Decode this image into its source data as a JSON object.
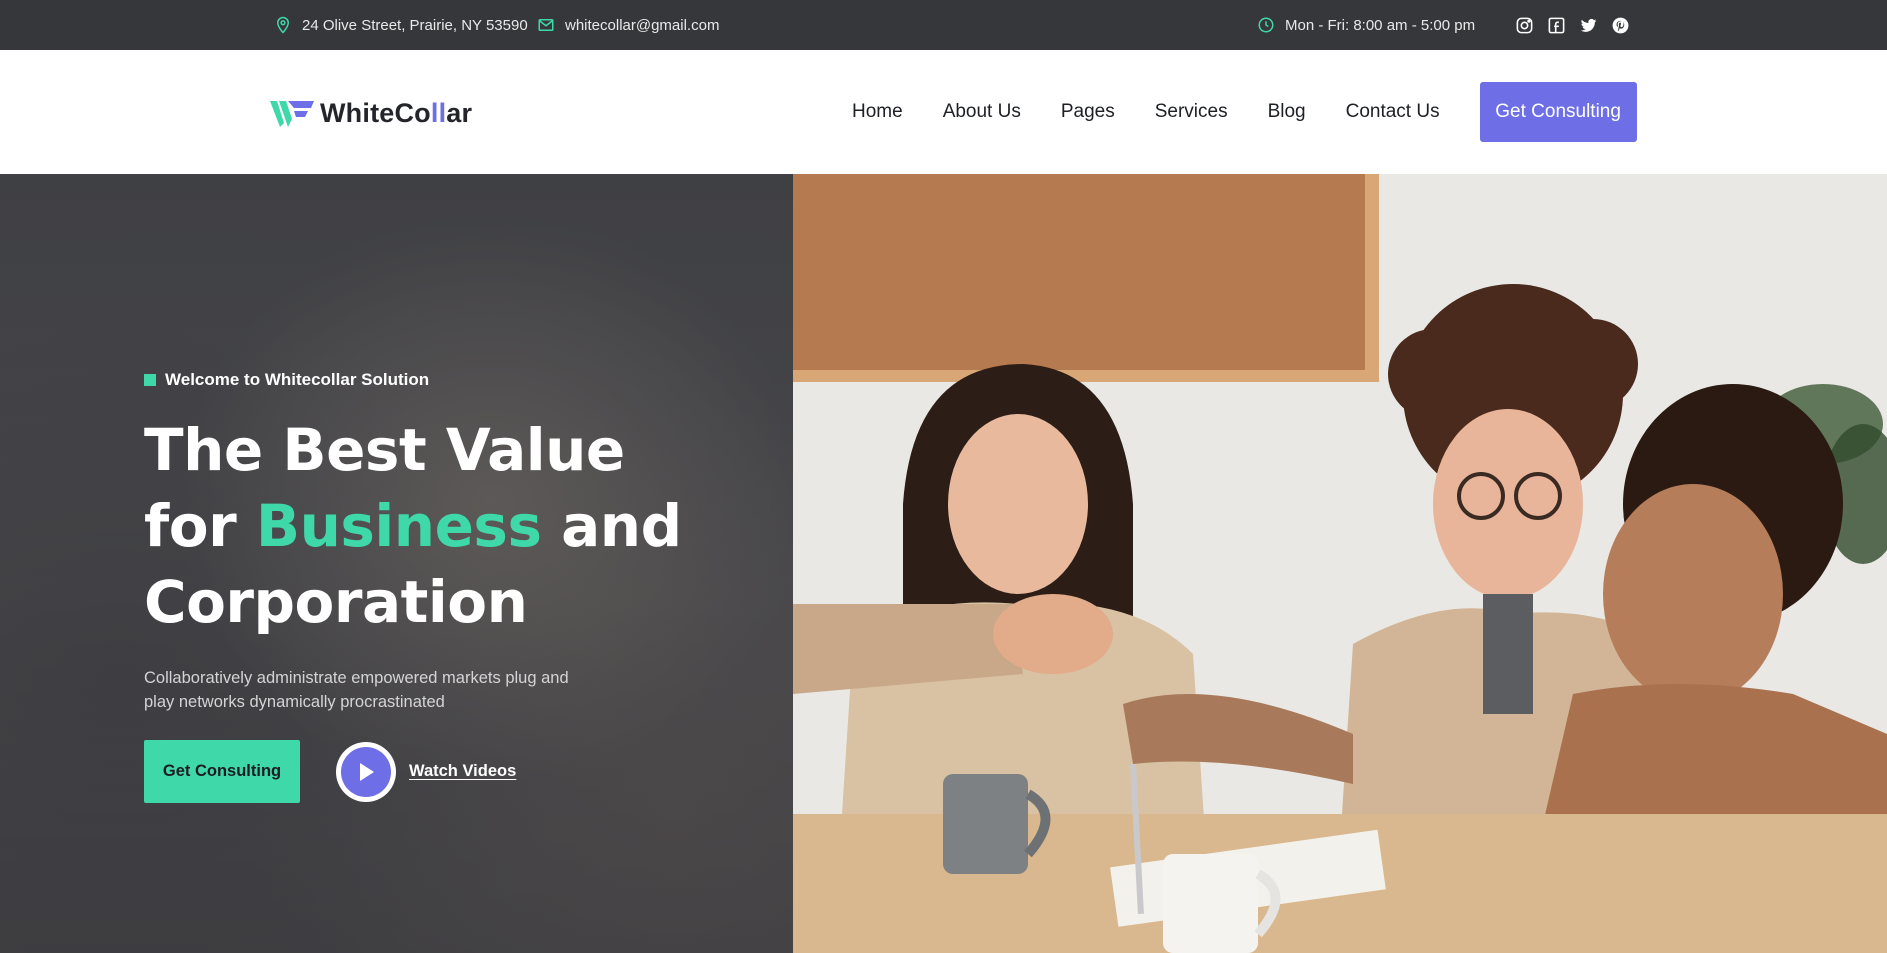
{
  "topbar": {
    "address": "24 Olive Street, Prairie, NY 53590",
    "email": "whitecollar@gmail.com",
    "hours": "Mon - Fri: 8:00 am - 5:00 pm",
    "icons": [
      "map-pin-icon",
      "mail-icon",
      "clock-icon"
    ],
    "social": [
      "instagram-icon",
      "facebook-icon",
      "twitter-icon",
      "pinterest-icon"
    ]
  },
  "header": {
    "logo_main": "WhiteCo",
    "logo_accent": "ll",
    "logo_end": "ar",
    "nav": [
      "Home",
      "About Us",
      "Pages",
      "Services",
      "Blog",
      "Contact Us"
    ],
    "cta": "Get Consulting"
  },
  "hero": {
    "tagline": "Welcome to Whitecollar Solution",
    "headline_line1": "The Best Value",
    "headline_for": "for ",
    "headline_highlight": "Business",
    "headline_and": " and",
    "headline_line3": "Corporation",
    "subtext": "Collaboratively administrate empowered markets plug and play networks dynamically procrastinated",
    "primary_button": "Get Consulting",
    "video_link": "Watch Videos"
  },
  "colors": {
    "accent_purple": "#6e6ee6",
    "accent_green": "#3fd8a8",
    "topbar_bg": "#36373b"
  }
}
